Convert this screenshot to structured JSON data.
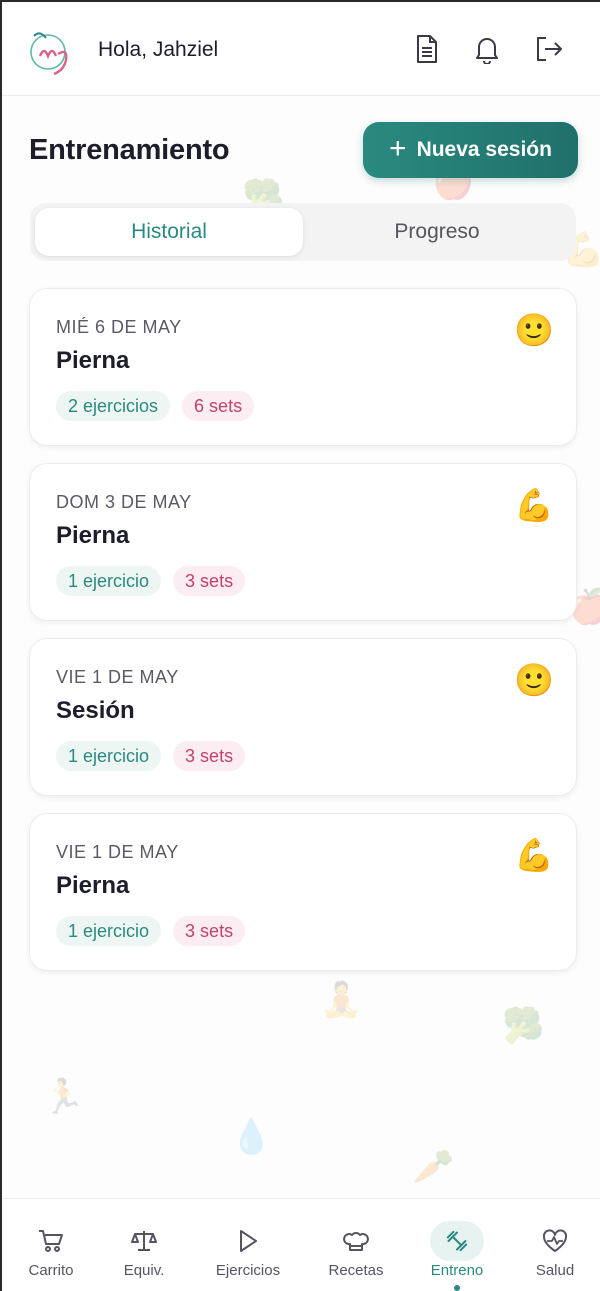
{
  "header": {
    "greeting": "Hola, Jahziel",
    "logo_icon": "mg-logo-icon",
    "actions": [
      {
        "name": "document-icon"
      },
      {
        "name": "bell-icon"
      },
      {
        "name": "logout-icon"
      }
    ]
  },
  "page": {
    "title": "Entrenamiento",
    "new_session_label": "Nueva sesión",
    "new_session_icon": "+"
  },
  "tabs": [
    {
      "label": "Historial",
      "active": true
    },
    {
      "label": "Progreso",
      "active": false
    }
  ],
  "sessions": [
    {
      "date": "MIÉ 6 DE MAY",
      "name": "Pierna",
      "exercises": "2 ejercicios",
      "sets": "6 sets",
      "mood": "🙂"
    },
    {
      "date": "DOM 3 DE MAY",
      "name": "Pierna",
      "exercises": "1 ejercicio",
      "sets": "3 sets",
      "mood": "💪"
    },
    {
      "date": "VIE 1 DE MAY",
      "name": "Sesión",
      "exercises": "1 ejercicio",
      "sets": "3 sets",
      "mood": "🙂"
    },
    {
      "date": "VIE 1 DE MAY",
      "name": "Pierna",
      "exercises": "1 ejercicio",
      "sets": "3 sets",
      "mood": "💪"
    }
  ],
  "bottom_nav": [
    {
      "label": "Carrito",
      "icon": "cart-icon"
    },
    {
      "label": "Equiv.",
      "icon": "scale-icon"
    },
    {
      "label": "Ejercicios",
      "icon": "play-icon"
    },
    {
      "label": "Recetas",
      "icon": "chef-hat-icon"
    },
    {
      "label": "Entreno",
      "icon": "dumbbell-icon",
      "active": true
    },
    {
      "label": "Salud",
      "icon": "heart-pulse-icon"
    }
  ],
  "colors": {
    "accent": "#2a8a80",
    "pink": "#c2426c",
    "text": "#1d1d2b"
  }
}
